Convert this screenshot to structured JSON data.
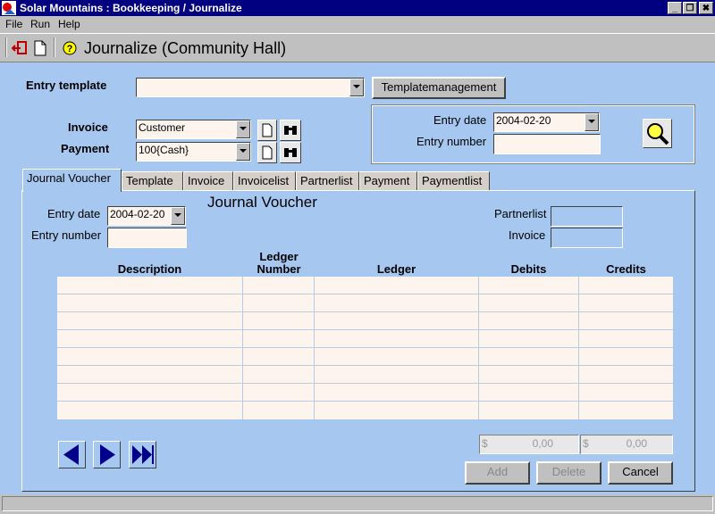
{
  "window": {
    "title": "Solar Mountains : Bookkeeping / Journalize",
    "minimize": "_",
    "maximize": "❐",
    "close": "✖"
  },
  "menu": {
    "file": "File",
    "run": "Run",
    "help": "Help"
  },
  "toolbar": {
    "title": "Journalize (Community Hall)",
    "icons": [
      "exit-icon",
      "new-document-icon",
      "help-icon"
    ]
  },
  "header": {
    "entry_template_label": "Entry template",
    "entry_template_value": "",
    "template_management_button": "Templatemanagement",
    "invoice_label": "Invoice",
    "invoice_value": "Customer",
    "payment_label": "Payment",
    "payment_value": "100{Cash}",
    "entry_date_label": "Entry date",
    "entry_date_value": "2004-02-20",
    "entry_number_label": "Entry number",
    "entry_number_value": ""
  },
  "tabs": [
    {
      "label": "Journal Voucher",
      "active": true
    },
    {
      "label": "Template"
    },
    {
      "label": "Invoice"
    },
    {
      "label": "Invoicelist"
    },
    {
      "label": "Partnerlist"
    },
    {
      "label": "Payment"
    },
    {
      "label": "Paymentlist"
    }
  ],
  "voucher": {
    "heading": "Journal Voucher",
    "entry_date_label": "Entry date",
    "entry_date_value": "2004-02-20",
    "entry_number_label": "Entry number",
    "entry_number_value": "",
    "partnerlist_label": "Partnerlist",
    "partnerlist_value": "",
    "invoice_label": "Invoice",
    "invoice_value": "",
    "columns": {
      "description": "Description",
      "ledger_number_1": "Ledger",
      "ledger_number_2": "Number",
      "ledger": "Ledger",
      "debits": "Debits",
      "credits": "Credits"
    },
    "total_debits_currency": "$",
    "total_debits": "0,00",
    "total_credits_currency": "$",
    "total_credits": "0,00",
    "add_button": "Add",
    "delete_button": "Delete",
    "cancel_button": "Cancel"
  }
}
